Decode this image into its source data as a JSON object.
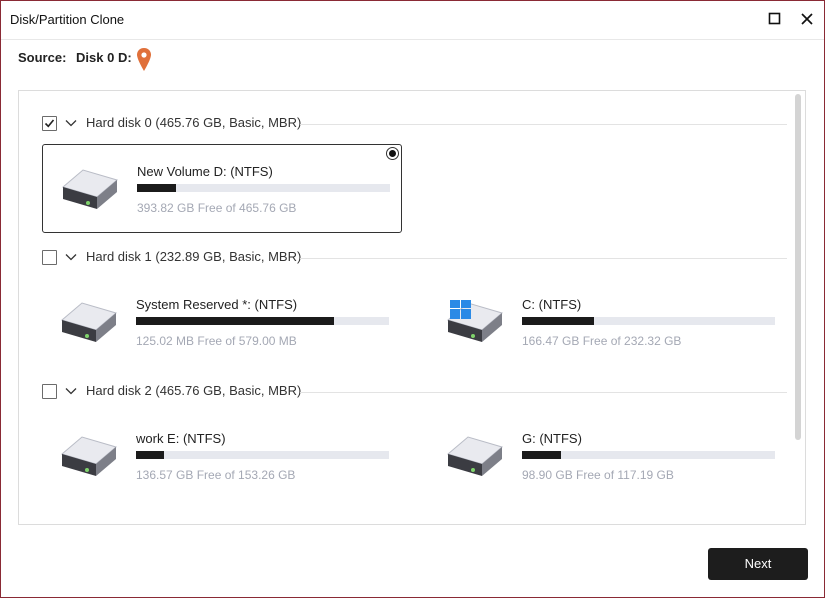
{
  "window": {
    "title": "Disk/Partition Clone"
  },
  "source": {
    "label": "Source:",
    "value": "Disk 0 D:"
  },
  "disks": [
    {
      "label": "Hard disk 0 (465.76 GB, Basic, MBR)",
      "checked": true,
      "partitions": [
        {
          "name": "New Volume D: (NTFS)",
          "free": "393.82 GB Free of 465.76 GB",
          "used_fraction": 0.154,
          "selected": true,
          "icon": "drive-icon"
        }
      ]
    },
    {
      "label": "Hard disk 1 (232.89 GB, Basic, MBR)",
      "checked": false,
      "partitions": [
        {
          "name": "System Reserved *: (NTFS)",
          "free": "125.02 MB Free of 579.00 MB",
          "used_fraction": 0.784,
          "selected": false,
          "icon": "drive-icon"
        },
        {
          "name": "C: (NTFS)",
          "free": "166.47 GB Free of 232.32 GB",
          "used_fraction": 0.283,
          "selected": false,
          "icon": "windows-drive-icon"
        }
      ]
    },
    {
      "label": "Hard disk 2 (465.76 GB, Basic, MBR)",
      "checked": false,
      "partitions": [
        {
          "name": "work E: (NTFS)",
          "free": "136.57 GB Free of 153.26 GB",
          "used_fraction": 0.109,
          "selected": false,
          "icon": "drive-icon"
        },
        {
          "name": "G: (NTFS)",
          "free": "98.90 GB Free of 117.19 GB",
          "used_fraction": 0.156,
          "selected": false,
          "icon": "drive-icon"
        }
      ]
    }
  ],
  "footer": {
    "next_label": "Next"
  },
  "colors": {
    "accent": "#1d1d1d",
    "window_border": "#8a2a35",
    "pin": "#e0703a",
    "windows_logo": "#2b8ae6"
  }
}
